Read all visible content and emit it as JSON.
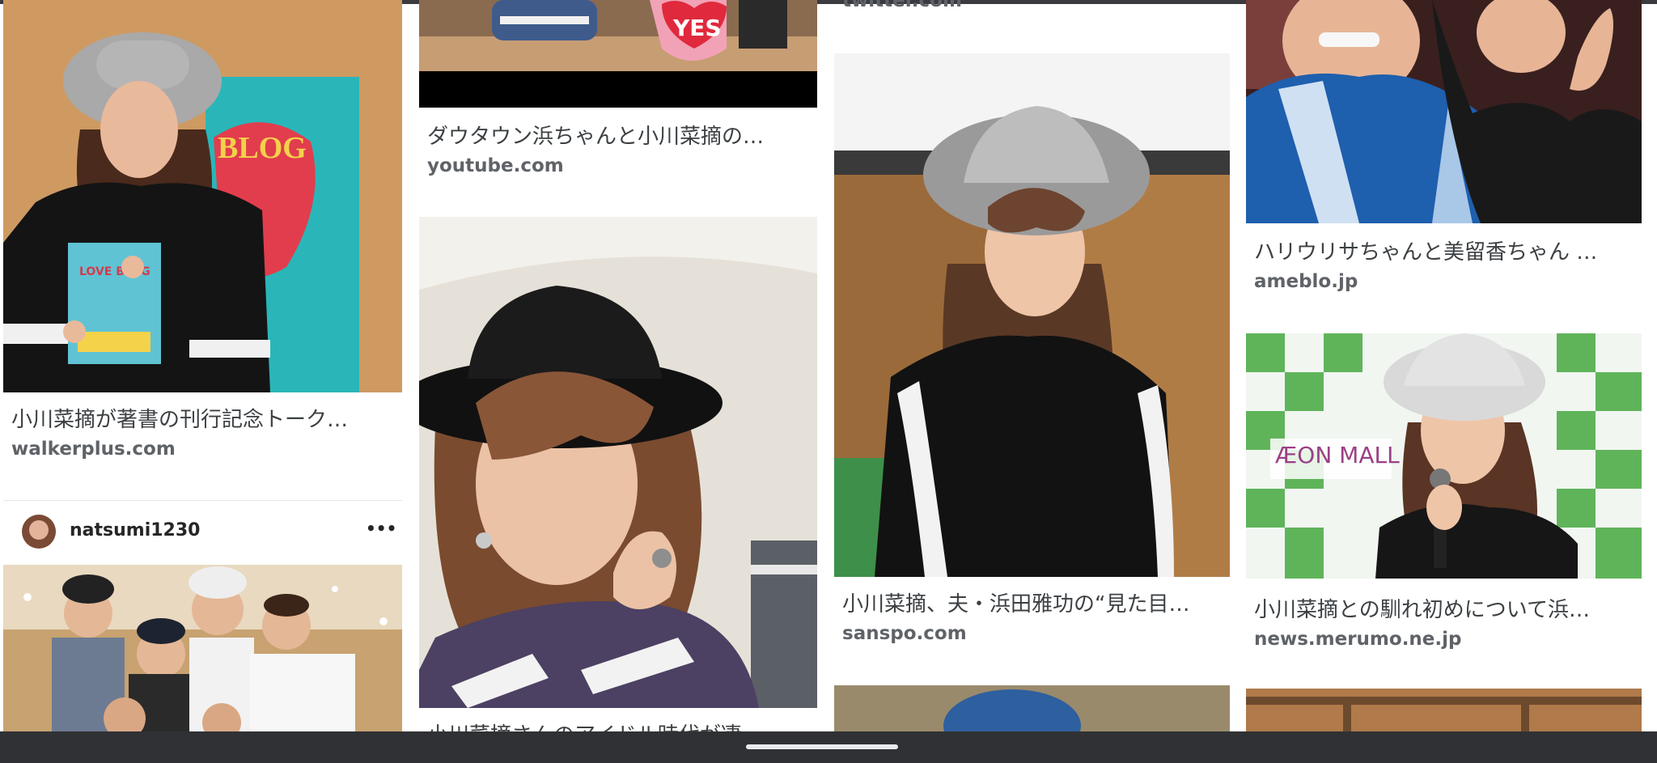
{
  "results": [
    {
      "caption": "小川菜摘が著書の刊行記念トーク…",
      "source": "walkerplus.com"
    },
    {
      "caption": "ダウタウン浜ちゃんと小川菜摘の…",
      "source": "youtube.com"
    },
    {
      "caption": "小川菜摘、夫・浜田雅功の“見た目…",
      "source": "sanspo.com"
    },
    {
      "caption": "ハリウリサちゃんと美留香ちゃん …",
      "source": "ameblo.jp"
    },
    {
      "caption": "小川菜摘との馴れ初めについて浜…",
      "source": "news.merumo.ne.jp"
    }
  ],
  "partial": {
    "top_source_col3": "twitter.com",
    "bottom_caption_col2": "小川菜摘さんのアイドル時代が凄…"
  },
  "instagram_post": {
    "username": "natsumi1230",
    "more": "•••"
  },
  "image_text": {
    "yes_sign": "YES",
    "book_title": "LOVE BLOG",
    "aeon_logo": "ÆON MALL"
  },
  "colors": {
    "caption": "#3c4043",
    "source": "#5f6368",
    "nav_bar": "#303134"
  }
}
